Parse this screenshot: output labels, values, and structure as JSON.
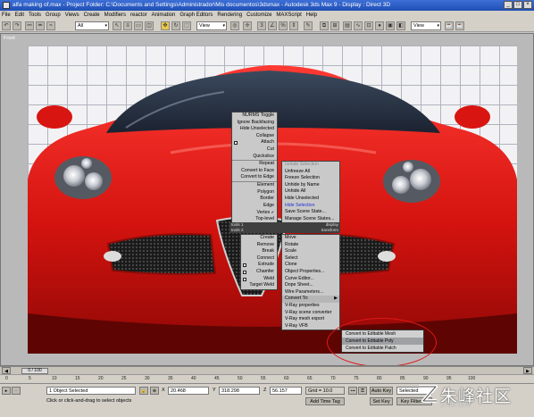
{
  "window": {
    "title": "alfa making of.max  -  Project Folder: C:\\Documents and Settings\\Administrador\\Mis documentos\\3dsmax   -   Autodesk 3ds Max 9      - Display : Direct 3D",
    "buttons": [
      "_",
      "□",
      "×"
    ]
  },
  "menubar": [
    "File",
    "Edit",
    "Tools",
    "Group",
    "Views",
    "Create",
    "Modifiers",
    "reactor",
    "Animation",
    "Graph Editors",
    "Rendering",
    "Customize",
    "MAXScript",
    "Help"
  ],
  "toolbar": {
    "filter_select": "All",
    "view_select_1": "View",
    "view_select_2": "View"
  },
  "viewport": {
    "label": "Front"
  },
  "quad_left_top": [
    "NURMS Toggle",
    "Ignore Backfacing",
    "Hide Unselected",
    "Collapse",
    "Attach",
    "Cut",
    "Quickslice",
    "Repeat",
    "Convert to Face",
    "Convert to Edge",
    "Element",
    "Polygon",
    "Border",
    "Edge",
    "Vertex",
    "Top-level"
  ],
  "quad_right_top": [
    "Isolate Selection",
    "Unfreeze All",
    "Freeze Selection",
    "Unhide by Name",
    "Unhide All",
    "Hide Unselected",
    "Hide Selection",
    "Save Scene State...",
    "Manage Scene States..."
  ],
  "quad_headers": {
    "tools1_left": "tools 1",
    "tools1_right": "display",
    "tools2_left": "tools 2",
    "tools2_right": "transform"
  },
  "quad_left_bottom": [
    "Create",
    "Remove",
    "Break",
    "Connect",
    "Extrude",
    "Chamfer",
    "Weld",
    "Target Weld"
  ],
  "quad_right_bottom": [
    "Move",
    "Rotate",
    "Scale",
    "Select",
    "Clone",
    "Object Properties...",
    "Curve Editor...",
    "Dope Sheet...",
    "Wire Parameters...",
    "Convert To:",
    "V-Ray properties",
    "V-Ray scene converter",
    "V-Ray mesh export",
    "V-Ray VFB"
  ],
  "submenu": [
    "Convert to Editable Mesh",
    "Convert to Editable Poly",
    "Convert to Editable Patch"
  ],
  "colors": {
    "accent_red": "#e01818",
    "title_blue": "#1f4fb5",
    "highlight_blue": "#2030d0"
  },
  "timeline": {
    "frame": "0 / 100",
    "ticks": [
      "0",
      "5",
      "10",
      "15",
      "20",
      "25",
      "30",
      "35",
      "40",
      "45",
      "50",
      "55",
      "60",
      "65",
      "70",
      "75",
      "80",
      "85",
      "90",
      "95",
      "100"
    ]
  },
  "status": {
    "selected": "1 Object Selected",
    "prompt": "Click or click-and-drag to select objects",
    "x_label": "X",
    "x": "20.468",
    "y_label": "Y",
    "y": "318.298",
    "z_label": "Z",
    "z": "56.157",
    "grid": "Grid = 10.0",
    "add_time_tag": "Add Time Tag",
    "auto_key": "Auto Key",
    "set_key": "Set Key",
    "selected_select": "Selected",
    "key_filters": "Key Filters..."
  },
  "watermark": {
    "text": "朱峰社区",
    "sub": "ZF3D.COM"
  }
}
